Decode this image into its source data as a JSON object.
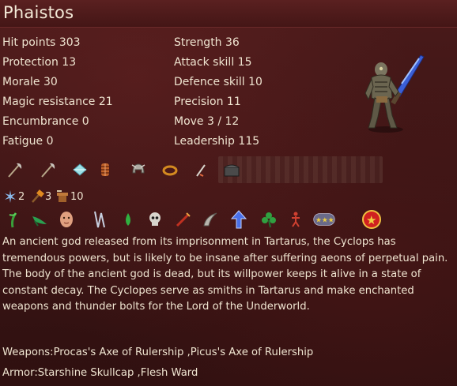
{
  "unit": {
    "name": "Phaistos"
  },
  "stats_left": [
    {
      "label": "Hit points",
      "value": "303"
    },
    {
      "label": "Protection",
      "value": "13"
    },
    {
      "label": "Morale",
      "value": "30"
    },
    {
      "label": "Magic resistance",
      "value": "21"
    },
    {
      "label": "Encumbrance",
      "value": "0"
    },
    {
      "label": "Fatigue",
      "value": "0"
    }
  ],
  "stats_right": [
    {
      "label": "Strength",
      "value": "36"
    },
    {
      "label": "Attack skill",
      "value": "15"
    },
    {
      "label": "Defence skill",
      "value": "10"
    },
    {
      "label": "Precision",
      "value": "11"
    },
    {
      "label": "Move",
      "value": "3 / 12"
    },
    {
      "label": "Leadership",
      "value": "115"
    }
  ],
  "equipment_icons": [
    "axe-icon",
    "axe-icon",
    "diamond-icon",
    "ribcage-armor-icon",
    "helmet-icon",
    "ring-icon",
    "sword-icon",
    "chest-icon"
  ],
  "counts": [
    {
      "icon": "air-magic-icon",
      "value": "2"
    },
    {
      "icon": "hammer-icon",
      "value": "3"
    },
    {
      "icon": "forge-icon",
      "value": "10"
    }
  ],
  "ability_icons": [
    "plant-icon",
    "poison-bird-icon",
    "face-icon",
    "blade-icon",
    "leaf-icon",
    "skull-icon",
    "sword-icon",
    "horn-icon",
    "arrow-up-icon",
    "clover-icon",
    "figure-icon",
    "stars-icon",
    "star-badge-icon"
  ],
  "description": "An ancient god released from its imprisonment in Tartarus, the Cyclops has tremendous powers, but is likely to be insane after suffering aeons of perpetual pain. The body of the ancient god is dead, but its willpower keeps it alive in a state of constant decay. The Cyclopes serve as smiths in Tartarus and make enchanted weapons and thunder bolts for the Lord of the Underworld.",
  "weapons": "Weapons:Procas's Axe of Rulership ,Picus's Axe of Rulership",
  "armor": "Armor:Starshine Skullcap ,Flesh Ward"
}
